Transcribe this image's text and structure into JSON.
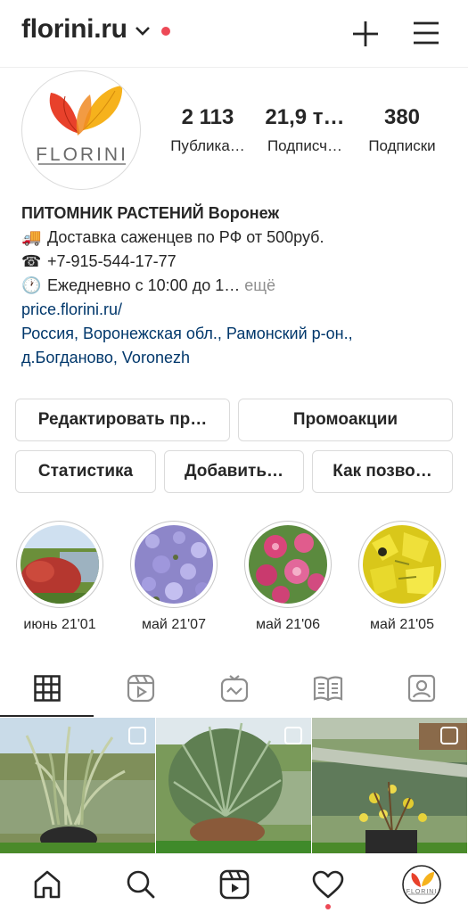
{
  "header": {
    "account_name": "florini.ru",
    "icons": [
      "chevron-down-icon",
      "plus-icon",
      "hamburger-menu-icon"
    ]
  },
  "profile": {
    "avatar_text": "FLORINI",
    "stats": [
      {
        "value": "2 113",
        "label": "Публика…"
      },
      {
        "value": "21,9 т…",
        "label": "Подписч…"
      },
      {
        "value": "380",
        "label": "Подписки"
      }
    ],
    "bio": {
      "name": "ПИТОМНИК РАСТЕНИЙ Воронеж",
      "line1": "Доставка саженцев по РФ от 500руб.",
      "line2": "+7-915-544-17-77",
      "line3": "Ежедневно с 10:00 до 1…",
      "more": "ещё",
      "link": "price.florini.ru/",
      "location_1": "Россия, Воронежская обл., Рамонский р-он.,",
      "location_2": "д.Богданово, Voronezh",
      "emojis": [
        "🚚",
        "☎",
        "🕐"
      ]
    }
  },
  "buttons": {
    "edit_profile": "Редактировать пр…",
    "promotions": "Промоакции",
    "insights": "Статистика",
    "add": "Добавить…",
    "how": "Как позво…"
  },
  "highlights": [
    {
      "label": "июнь 21'01"
    },
    {
      "label": "май 21'07"
    },
    {
      "label": "май 21'06"
    },
    {
      "label": "май 21'05"
    }
  ],
  "tabs": [
    "grid-icon",
    "reels-icon",
    "igtv-icon",
    "guides-icon",
    "tagged-icon"
  ],
  "bottom_nav": [
    "home-icon",
    "search-icon",
    "reels-icon",
    "heart-icon",
    "profile-avatar"
  ],
  "colors": {
    "notification": "#ed4956",
    "link": "#00376b",
    "border": "#dbdbdb",
    "muted": "#8e8e8e"
  }
}
